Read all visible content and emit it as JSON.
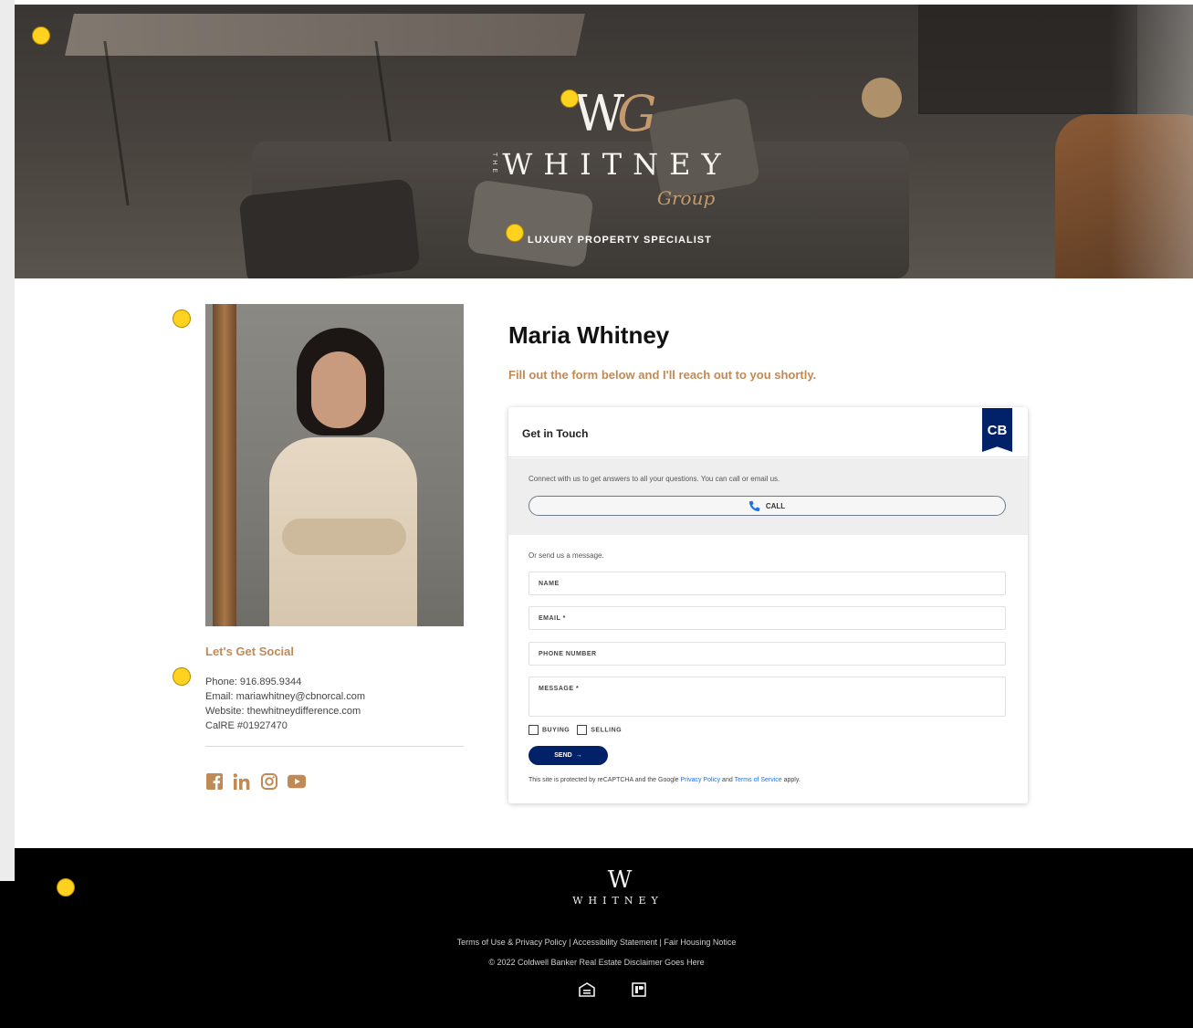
{
  "hero": {
    "logo_monogram": "W",
    "logo_the": "THE",
    "logo_name": "WHITNEY",
    "logo_group": "Group",
    "tagline": "LUXURY PROPERTY SPECIALIST"
  },
  "profile": {
    "social_title": "Let's Get Social",
    "contact": [
      "Phone: 916.895.9344",
      "Email: mariawhitney@cbnorcal.com",
      "Website: thewhitneydifference.com",
      "CalRE #01927470"
    ],
    "social_icons": [
      "facebook-icon",
      "linkedin-icon",
      "instagram-icon",
      "youtube-icon"
    ]
  },
  "main": {
    "name": "Maria Whitney",
    "intro": "Fill out the form below and I'll reach out to you shortly."
  },
  "form": {
    "title": "Get in Touch",
    "badge": "CB",
    "call_text": "Connect with us to get answers to all your questions. You can call or email us.",
    "call_label": "CALL",
    "message_text": "Or send us a message.",
    "fields": {
      "name": "NAME",
      "email": "EMAIL *",
      "phone": "PHONE NUMBER",
      "message": "MESSAGE *"
    },
    "buying_label": "BUYING",
    "selling_label": "SELLING",
    "send_label": "SEND",
    "recaptcha_pre": "This site is protected by reCAPTCHA and the Google ",
    "privacy_link": "Privacy Policy",
    "and_text": " and ",
    "terms_link": "Terms of Service",
    "apply_text": " apply."
  },
  "footer": {
    "logo_monogram": "W",
    "logo_name": "WHITNEY",
    "links": "Terms of Use  &  Privacy Policy | Accessibility Statement | Fair Housing Notice",
    "copyright": "© 2022 Coldwell Banker Real Estate Disclaimer Goes Here",
    "icons": [
      "equal-housing-icon",
      "realtor-icon"
    ]
  },
  "colors": {
    "accent": "#c08a56",
    "brand_navy": "#012169",
    "marker": "#ffd21f"
  }
}
